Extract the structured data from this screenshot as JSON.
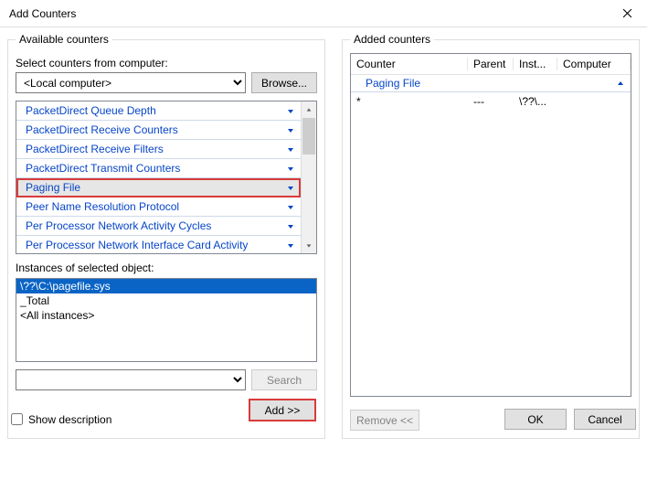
{
  "window": {
    "title": "Add Counters"
  },
  "left": {
    "groupbox": "Available counters",
    "select_label": "Select counters from computer:",
    "computer_value": "<Local computer>",
    "browse": "Browse...",
    "counters": [
      {
        "label": "PacketDirect Queue Depth",
        "highlight": false
      },
      {
        "label": "PacketDirect Receive Counters",
        "highlight": false
      },
      {
        "label": "PacketDirect Receive Filters",
        "highlight": false
      },
      {
        "label": "PacketDirect Transmit Counters",
        "highlight": false
      },
      {
        "label": "Paging File",
        "highlight": true
      },
      {
        "label": "Peer Name Resolution Protocol",
        "highlight": false
      },
      {
        "label": "Per Processor Network Activity Cycles",
        "highlight": false
      },
      {
        "label": "Per Processor Network Interface Card Activity",
        "highlight": false
      }
    ],
    "instances_label": "Instances of selected object:",
    "instances": [
      {
        "label": "\\??\\C:\\pagefile.sys",
        "selected": true
      },
      {
        "label": "_Total",
        "selected": false
      },
      {
        "label": "<All instances>",
        "selected": false
      }
    ],
    "search": "Search",
    "add": "Add >>"
  },
  "right": {
    "groupbox": "Added counters",
    "headers": {
      "counter": "Counter",
      "parent": "Parent",
      "inst": "Inst...",
      "computer": "Computer"
    },
    "rows": [
      {
        "type": "group",
        "counter": "Paging File"
      },
      {
        "type": "item",
        "counter": "*",
        "parent": "---",
        "inst": "\\??\\...",
        "computer": ""
      }
    ],
    "remove": "Remove <<"
  },
  "footer": {
    "show_desc": "Show description",
    "ok": "OK",
    "cancel": "Cancel"
  }
}
